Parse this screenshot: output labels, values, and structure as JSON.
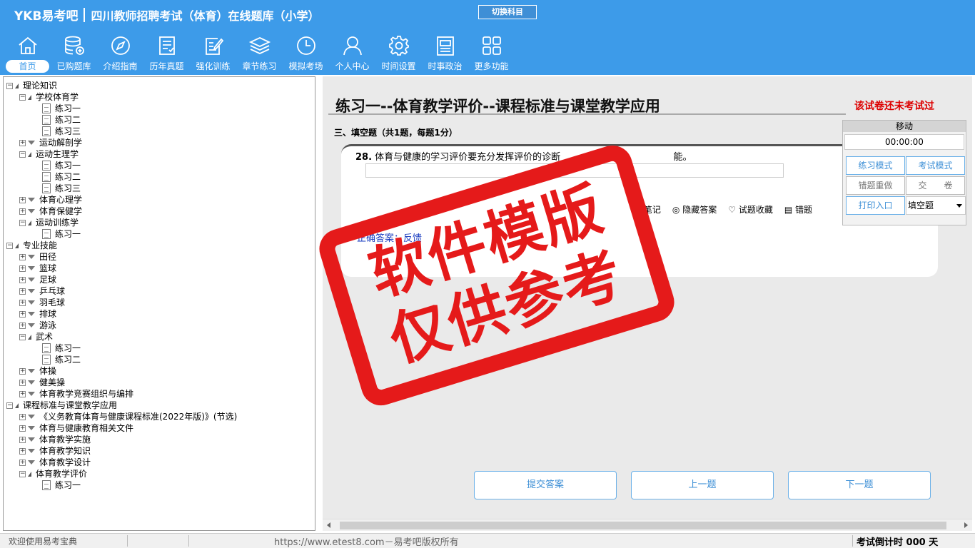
{
  "header": {
    "logo": "YKB易考吧",
    "title": "四川教师招聘考试（体育）在线题库（小学）",
    "switch_label": "切换科目"
  },
  "nav": [
    {
      "label": "首页",
      "icon": "home-icon"
    },
    {
      "label": "已购题库",
      "icon": "database-icon"
    },
    {
      "label": "介绍指南",
      "icon": "compass-icon"
    },
    {
      "label": "历年真题",
      "icon": "checklist-icon"
    },
    {
      "label": "强化训练",
      "icon": "edit-icon"
    },
    {
      "label": "章节练习",
      "icon": "layers-icon"
    },
    {
      "label": "模拟考场",
      "icon": "clock-icon"
    },
    {
      "label": "个人中心",
      "icon": "user-icon"
    },
    {
      "label": "时间设置",
      "icon": "gear-icon"
    },
    {
      "label": "时事政治",
      "icon": "newspaper-icon"
    },
    {
      "label": "更多功能",
      "icon": "grid-icon"
    }
  ],
  "tree": [
    {
      "level": 0,
      "type": "open",
      "label": "理论知识"
    },
    {
      "level": 1,
      "type": "open",
      "label": "学校体育学"
    },
    {
      "level": 2,
      "type": "doc",
      "label": "练习一"
    },
    {
      "level": 2,
      "type": "doc",
      "label": "练习二"
    },
    {
      "level": 2,
      "type": "doc",
      "label": "练习三"
    },
    {
      "level": 1,
      "type": "closed",
      "label": "运动解剖学"
    },
    {
      "level": 1,
      "type": "open",
      "label": "运动生理学"
    },
    {
      "level": 2,
      "type": "doc",
      "label": "练习一"
    },
    {
      "level": 2,
      "type": "doc",
      "label": "练习二"
    },
    {
      "level": 2,
      "type": "doc",
      "label": "练习三"
    },
    {
      "level": 1,
      "type": "closed",
      "label": "体育心理学"
    },
    {
      "level": 1,
      "type": "closed",
      "label": "体育保健学"
    },
    {
      "level": 1,
      "type": "open",
      "label": "运动训练学"
    },
    {
      "level": 2,
      "type": "doc",
      "label": "练习一"
    },
    {
      "level": 0,
      "type": "open",
      "label": "专业技能"
    },
    {
      "level": 1,
      "type": "closed",
      "label": "田径"
    },
    {
      "level": 1,
      "type": "closed",
      "label": "篮球"
    },
    {
      "level": 1,
      "type": "closed",
      "label": "足球"
    },
    {
      "level": 1,
      "type": "closed",
      "label": "乒乓球"
    },
    {
      "level": 1,
      "type": "closed",
      "label": "羽毛球"
    },
    {
      "level": 1,
      "type": "closed",
      "label": "排球"
    },
    {
      "level": 1,
      "type": "closed",
      "label": "游泳"
    },
    {
      "level": 1,
      "type": "open",
      "label": "武术"
    },
    {
      "level": 2,
      "type": "doc",
      "label": "练习一"
    },
    {
      "level": 2,
      "type": "doc",
      "label": "练习二"
    },
    {
      "level": 1,
      "type": "closed",
      "label": "体操"
    },
    {
      "level": 1,
      "type": "closed",
      "label": "健美操"
    },
    {
      "level": 1,
      "type": "closed",
      "label": "体育教学竞赛组织与编排"
    },
    {
      "level": 0,
      "type": "open",
      "label": "课程标准与课堂教学应用"
    },
    {
      "level": 1,
      "type": "closed",
      "label": "《义务教育体育与健康课程标准(2022年版)》(节选)"
    },
    {
      "level": 1,
      "type": "closed",
      "label": "体育与健康教育相关文件"
    },
    {
      "level": 1,
      "type": "closed",
      "label": "体育教学实施"
    },
    {
      "level": 1,
      "type": "closed",
      "label": "体育教学知识"
    },
    {
      "level": 1,
      "type": "closed",
      "label": "体育教学设计"
    },
    {
      "level": 1,
      "type": "open",
      "label": "体育教学评价"
    },
    {
      "level": 2,
      "type": "doc",
      "label": "练习一"
    }
  ],
  "main": {
    "exercise_title": "练习一--体育教学评价--课程标准与课堂教学应用",
    "status_note": "该试卷还未考试过",
    "section": "三、填空题（共1题，每题1分）",
    "question_number": "28.",
    "question_text": "体育与健康的学习评价要充分发挥评价的诊断",
    "question_tail": "能。",
    "answer_value": "",
    "toolbar": [
      "笔记",
      "隐藏答案",
      "试题收藏",
      "错题"
    ],
    "correct_answer": "正确答案：反馈"
  },
  "mode_panel": {
    "head": "移动",
    "timer": "00:00:00",
    "practice_mode": "练习模式",
    "exam_mode": "考试模式",
    "redo_wrong": "错题重做",
    "submit_paper": "交　　卷",
    "print_entry": "打印入口",
    "question_type": "填空题"
  },
  "buttons": {
    "submit_answer": "提交答案",
    "prev": "上一题",
    "next": "下一题"
  },
  "status": {
    "welcome": "欢迎使用易考宝典",
    "copyright": "https://www.etest8.com－易考吧版权所有",
    "countdown": "考试倒计时 000 天"
  },
  "watermark": {
    "line1": "软件模版",
    "line2": "仅供参考"
  },
  "colors": {
    "header_bg": "#3d9be9",
    "stamp_red": "#e51a1a",
    "warning_red": "#dd0000",
    "button_blue": "#3d8fd6"
  }
}
